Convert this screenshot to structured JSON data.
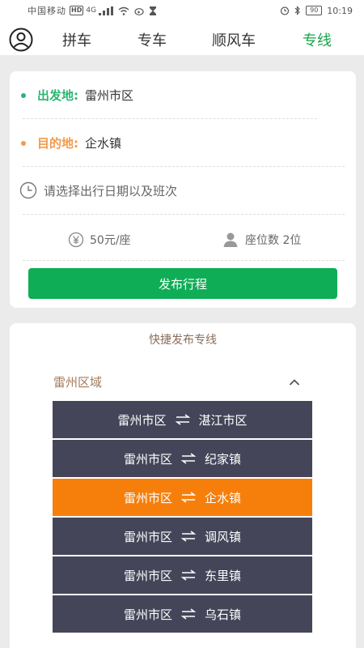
{
  "status_bar": {
    "carrier": "中国移动",
    "hd": "HD",
    "signal": "4G",
    "battery": "90",
    "time": "10:19"
  },
  "nav": {
    "tabs": [
      {
        "label": "拼车",
        "active": false
      },
      {
        "label": "专车",
        "active": false
      },
      {
        "label": "顺风车",
        "active": false
      },
      {
        "label": "专线",
        "active": true
      }
    ]
  },
  "form": {
    "origin_label": "出发地:",
    "origin_value": "雷州市区",
    "dest_label": "目的地:",
    "dest_value": "企水镇",
    "time_placeholder": "请选择出行日期以及班次",
    "price": "50元/座",
    "seats": "座位数 2位",
    "publish_label": "发布行程"
  },
  "quick": {
    "title": "快捷发布专线",
    "region": "雷州区域",
    "routes": [
      {
        "from": "雷州市区",
        "to": "湛江市区",
        "active": false
      },
      {
        "from": "雷州市区",
        "to": "纪家镇",
        "active": false
      },
      {
        "from": "雷州市区",
        "to": "企水镇",
        "active": true
      },
      {
        "from": "雷州市区",
        "to": "调风镇",
        "active": false
      },
      {
        "from": "雷州市区",
        "to": "东里镇",
        "active": false
      },
      {
        "from": "雷州市区",
        "to": "乌石镇",
        "active": false
      }
    ]
  },
  "colors": {
    "accent_green": "#0fad56",
    "active_tab": "#16a34a",
    "origin_dot": "#2bb673",
    "dest_dot": "#f39a4a",
    "route_bg": "#45455a",
    "route_active": "#f67f0c"
  },
  "icons": {
    "avatar": "user-circle-icon",
    "clock": "clock-icon",
    "price": "yuan-icon",
    "seat": "person-icon",
    "caret": "chevron-up-icon",
    "route": "swap-arrows-icon"
  }
}
